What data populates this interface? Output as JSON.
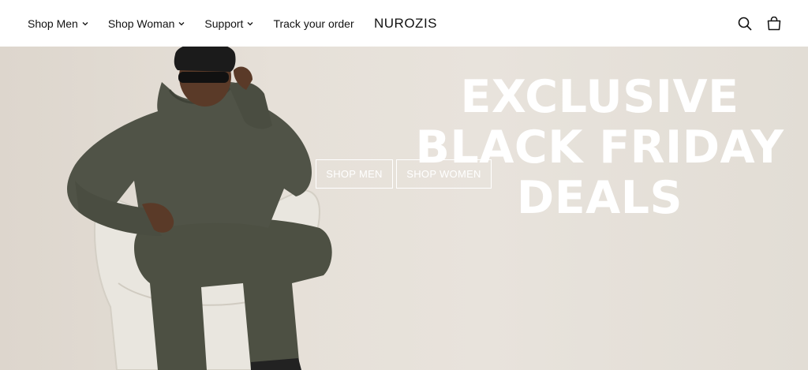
{
  "header": {
    "nav": [
      {
        "label": "Shop Men",
        "has_dropdown": true
      },
      {
        "label": "Shop Woman",
        "has_dropdown": true
      },
      {
        "label": "Support",
        "has_dropdown": true
      },
      {
        "label": "Track your order",
        "has_dropdown": false
      }
    ],
    "logo": "NUROZIS",
    "icons": [
      "search-icon",
      "cart-icon"
    ]
  },
  "hero": {
    "title_line1": "EXCLUSIVE",
    "title_line2": "BLACK FRIDAY",
    "title_line3": "DEALS",
    "button_men": "SHOP MEN",
    "button_women": "SHOP WOMEN"
  },
  "colors": {
    "header_bg": "#ffffff",
    "text": "#121212",
    "hero_bg": "#e4dfd7",
    "hero_text": "#ffffff",
    "outfit": "#4e5144"
  }
}
